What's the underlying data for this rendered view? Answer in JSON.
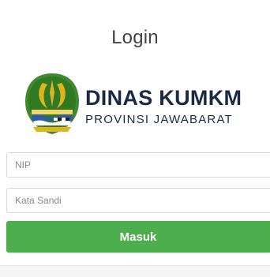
{
  "login": {
    "title": "Login",
    "brand_name": "DINAS KUMKM",
    "brand_sub": "PROVINSI JAWABARAT",
    "nip_placeholder": "NIP",
    "password_placeholder": "Kata Sandi",
    "submit_label": "Masuk"
  },
  "colors": {
    "brand_text": "#1b2a44",
    "button": "#4cae4c",
    "logo_green": "#3f8a2e",
    "logo_gold": "#e0b41f"
  },
  "icons": [
    "jawa-barat-emblem-logo"
  ]
}
